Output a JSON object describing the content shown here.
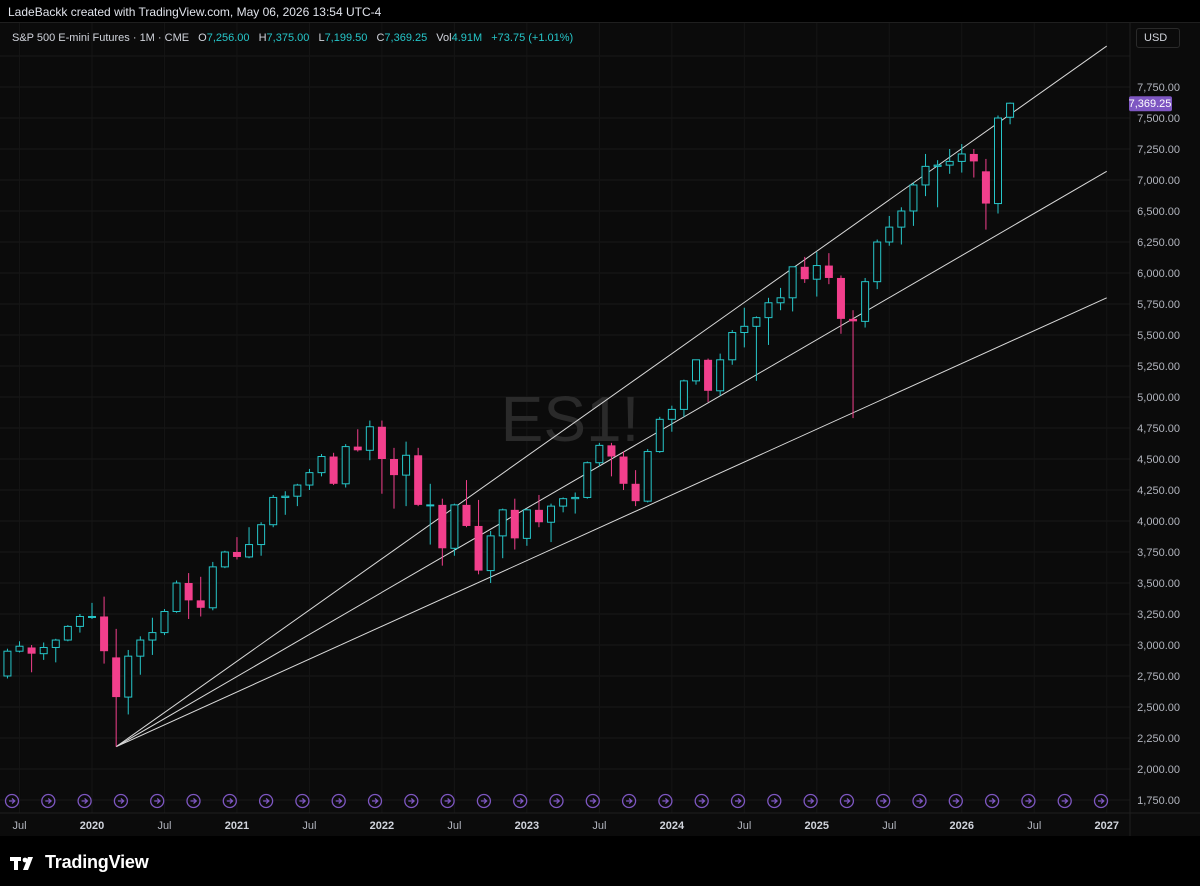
{
  "header": {
    "text": "LadeBackk created with TradingView.com, May 06, 2026 13:54 UTC-4"
  },
  "legend": {
    "symbol": "S&P 500 E-mini Futures · 1M · CME",
    "open_label": "O",
    "open": "7,256.00",
    "high_label": "H",
    "high": "7,375.00",
    "low_label": "L",
    "low": "7,199.50",
    "close_label": "C",
    "close": "7,369.25",
    "vol_label": "Vol",
    "vol": "4.91M",
    "change": "+73.75 (+1.01%)"
  },
  "currency_button": "USD",
  "watermark": "ES1!",
  "price_tag": {
    "value": "7,369.25",
    "color": "#7e57c2"
  },
  "brand": {
    "name": "TradingView"
  },
  "colors": {
    "up": "#26c6c9",
    "down": "#f23f8c",
    "line": "#d9d9d9",
    "event": "#7e57c2"
  },
  "chart_data": {
    "type": "candlestick",
    "interval": "1M",
    "y_ticks": [
      1750,
      2000,
      2250,
      2500,
      2750,
      3000,
      3250,
      3500,
      3750,
      4000,
      4250,
      4500,
      4750,
      5000,
      5250,
      5500,
      5750,
      6000,
      6250,
      6500,
      6750,
      7000,
      7250,
      7500,
      7750
    ],
    "y_tick_labels": [
      "1,750.00",
      "2,000.00",
      "2,250.00",
      "2,500.00",
      "2,750.00",
      "3,000.00",
      "3,250.00",
      "3,500.00",
      "3,750.00",
      "4,000.00",
      "4,250.00",
      "4,500.00",
      "4,750.00",
      "5,000.00",
      "5,250.00",
      "5,500.00",
      "5,750.00",
      "6,000.00",
      "6,250.00",
      "6,500.00",
      "7,000.00",
      "7,250.00",
      "7,500.00",
      "7,750.00"
    ],
    "x_ticks": [
      {
        "label": "Jul",
        "date": "2019-07",
        "bold": false
      },
      {
        "label": "2020",
        "date": "2020-01",
        "bold": true
      },
      {
        "label": "Jul",
        "date": "2020-07",
        "bold": false
      },
      {
        "label": "2021",
        "date": "2021-01",
        "bold": true
      },
      {
        "label": "Jul",
        "date": "2021-07",
        "bold": false
      },
      {
        "label": "2022",
        "date": "2022-01",
        "bold": true
      },
      {
        "label": "Jul",
        "date": "2022-07",
        "bold": false
      },
      {
        "label": "2023",
        "date": "2023-01",
        "bold": true
      },
      {
        "label": "Jul",
        "date": "2023-07",
        "bold": false
      },
      {
        "label": "2024",
        "date": "2024-01",
        "bold": true
      },
      {
        "label": "Jul",
        "date": "2024-07",
        "bold": false
      },
      {
        "label": "2025",
        "date": "2025-01",
        "bold": true
      },
      {
        "label": "Jul",
        "date": "2025-07",
        "bold": false
      },
      {
        "label": "2026",
        "date": "2026-01",
        "bold": true
      },
      {
        "label": "Jul",
        "date": "2026-07",
        "bold": false
      },
      {
        "label": "2027",
        "date": "2027-01",
        "bold": true
      }
    ],
    "candles": [
      {
        "t": "2019-06",
        "o": 2750,
        "h": 2970,
        "l": 2730,
        "c": 2950
      },
      {
        "t": "2019-07",
        "o": 2950,
        "h": 3030,
        "l": 2940,
        "c": 2990
      },
      {
        "t": "2019-08",
        "o": 2980,
        "h": 3000,
        "l": 2780,
        "c": 2930
      },
      {
        "t": "2019-09",
        "o": 2930,
        "h": 3020,
        "l": 2880,
        "c": 2980
      },
      {
        "t": "2019-10",
        "o": 2980,
        "h": 3050,
        "l": 2860,
        "c": 3040
      },
      {
        "t": "2019-11",
        "o": 3040,
        "h": 3160,
        "l": 3030,
        "c": 3150
      },
      {
        "t": "2019-12",
        "o": 3150,
        "h": 3250,
        "l": 3100,
        "c": 3230
      },
      {
        "t": "2020-01",
        "o": 3230,
        "h": 3340,
        "l": 3210,
        "c": 3230
      },
      {
        "t": "2020-02",
        "o": 3230,
        "h": 3390,
        "l": 2850,
        "c": 2950
      },
      {
        "t": "2020-03",
        "o": 2900,
        "h": 3130,
        "l": 2180,
        "c": 2580
      },
      {
        "t": "2020-04",
        "o": 2580,
        "h": 2960,
        "l": 2440,
        "c": 2910
      },
      {
        "t": "2020-05",
        "o": 2910,
        "h": 3070,
        "l": 2760,
        "c": 3040
      },
      {
        "t": "2020-06",
        "o": 3040,
        "h": 3220,
        "l": 2920,
        "c": 3100
      },
      {
        "t": "2020-07",
        "o": 3100,
        "h": 3290,
        "l": 3080,
        "c": 3270
      },
      {
        "t": "2020-08",
        "o": 3270,
        "h": 3520,
        "l": 3260,
        "c": 3500
      },
      {
        "t": "2020-09",
        "o": 3500,
        "h": 3580,
        "l": 3210,
        "c": 3360
      },
      {
        "t": "2020-10",
        "o": 3360,
        "h": 3550,
        "l": 3230,
        "c": 3300
      },
      {
        "t": "2020-11",
        "o": 3300,
        "h": 3670,
        "l": 3280,
        "c": 3630
      },
      {
        "t": "2020-12",
        "o": 3630,
        "h": 3760,
        "l": 3620,
        "c": 3750
      },
      {
        "t": "2021-01",
        "o": 3750,
        "h": 3870,
        "l": 3690,
        "c": 3710
      },
      {
        "t": "2021-02",
        "o": 3710,
        "h": 3950,
        "l": 3700,
        "c": 3810
      },
      {
        "t": "2021-03",
        "o": 3810,
        "h": 3990,
        "l": 3720,
        "c": 3970
      },
      {
        "t": "2021-04",
        "o": 3970,
        "h": 4210,
        "l": 3950,
        "c": 4190
      },
      {
        "t": "2021-05",
        "o": 4190,
        "h": 4240,
        "l": 4050,
        "c": 4200
      },
      {
        "t": "2021-06",
        "o": 4200,
        "h": 4300,
        "l": 4120,
        "c": 4290
      },
      {
        "t": "2021-07",
        "o": 4290,
        "h": 4420,
        "l": 4250,
        "c": 4390
      },
      {
        "t": "2021-08",
        "o": 4390,
        "h": 4540,
        "l": 4360,
        "c": 4520
      },
      {
        "t": "2021-09",
        "o": 4520,
        "h": 4550,
        "l": 4290,
        "c": 4300
      },
      {
        "t": "2021-10",
        "o": 4300,
        "h": 4620,
        "l": 4270,
        "c": 4600
      },
      {
        "t": "2021-11",
        "o": 4600,
        "h": 4740,
        "l": 4560,
        "c": 4570
      },
      {
        "t": "2021-12",
        "o": 4570,
        "h": 4810,
        "l": 4490,
        "c": 4760
      },
      {
        "t": "2022-01",
        "o": 4760,
        "h": 4810,
        "l": 4220,
        "c": 4500
      },
      {
        "t": "2022-02",
        "o": 4500,
        "h": 4590,
        "l": 4100,
        "c": 4370
      },
      {
        "t": "2022-03",
        "o": 4370,
        "h": 4640,
        "l": 4120,
        "c": 4530
      },
      {
        "t": "2022-04",
        "o": 4530,
        "h": 4590,
        "l": 4120,
        "c": 4130
      },
      {
        "t": "2022-05",
        "o": 4130,
        "h": 4300,
        "l": 3810,
        "c": 4130
      },
      {
        "t": "2022-06",
        "o": 4130,
        "h": 4180,
        "l": 3640,
        "c": 3780
      },
      {
        "t": "2022-07",
        "o": 3780,
        "h": 4140,
        "l": 3720,
        "c": 4130
      },
      {
        "t": "2022-08",
        "o": 4130,
        "h": 4330,
        "l": 3950,
        "c": 3960
      },
      {
        "t": "2022-09",
        "o": 3960,
        "h": 4170,
        "l": 3570,
        "c": 3600
      },
      {
        "t": "2022-10",
        "o": 3600,
        "h": 3920,
        "l": 3500,
        "c": 3880
      },
      {
        "t": "2022-11",
        "o": 3880,
        "h": 4100,
        "l": 3700,
        "c": 4090
      },
      {
        "t": "2022-12",
        "o": 4090,
        "h": 4180,
        "l": 3770,
        "c": 3860
      },
      {
        "t": "2023-01",
        "o": 3860,
        "h": 4100,
        "l": 3800,
        "c": 4090
      },
      {
        "t": "2023-02",
        "o": 4090,
        "h": 4210,
        "l": 3950,
        "c": 3990
      },
      {
        "t": "2023-03",
        "o": 3990,
        "h": 4140,
        "l": 3830,
        "c": 4120
      },
      {
        "t": "2023-04",
        "o": 4120,
        "h": 4190,
        "l": 4070,
        "c": 4180
      },
      {
        "t": "2023-05",
        "o": 4180,
        "h": 4230,
        "l": 4060,
        "c": 4190
      },
      {
        "t": "2023-06",
        "o": 4190,
        "h": 4480,
        "l": 4180,
        "c": 4470
      },
      {
        "t": "2023-07",
        "o": 4470,
        "h": 4630,
        "l": 4440,
        "c": 4610
      },
      {
        "t": "2023-08",
        "o": 4610,
        "h": 4630,
        "l": 4360,
        "c": 4520
      },
      {
        "t": "2023-09",
        "o": 4520,
        "h": 4560,
        "l": 4250,
        "c": 4300
      },
      {
        "t": "2023-10",
        "o": 4300,
        "h": 4410,
        "l": 4120,
        "c": 4160
      },
      {
        "t": "2023-11",
        "o": 4160,
        "h": 4580,
        "l": 4150,
        "c": 4560
      },
      {
        "t": "2023-12",
        "o": 4560,
        "h": 4840,
        "l": 4550,
        "c": 4820
      },
      {
        "t": "2024-01",
        "o": 4820,
        "h": 4930,
        "l": 4720,
        "c": 4900
      },
      {
        "t": "2024-02",
        "o": 4900,
        "h": 5140,
        "l": 4840,
        "c": 5130
      },
      {
        "t": "2024-03",
        "o": 5130,
        "h": 5300,
        "l": 5100,
        "c": 5300
      },
      {
        "t": "2024-04",
        "o": 5300,
        "h": 5310,
        "l": 4960,
        "c": 5050
      },
      {
        "t": "2024-05",
        "o": 5050,
        "h": 5350,
        "l": 5010,
        "c": 5300
      },
      {
        "t": "2024-06",
        "o": 5300,
        "h": 5540,
        "l": 5260,
        "c": 5520
      },
      {
        "t": "2024-07",
        "o": 5520,
        "h": 5720,
        "l": 5400,
        "c": 5570
      },
      {
        "t": "2024-08",
        "o": 5570,
        "h": 5650,
        "l": 5130,
        "c": 5640
      },
      {
        "t": "2024-09",
        "o": 5640,
        "h": 5800,
        "l": 5420,
        "c": 5760
      },
      {
        "t": "2024-10",
        "o": 5760,
        "h": 5880,
        "l": 5700,
        "c": 5800
      },
      {
        "t": "2024-11",
        "o": 5800,
        "h": 6050,
        "l": 5690,
        "c": 6050
      },
      {
        "t": "2024-12",
        "o": 6050,
        "h": 6130,
        "l": 5920,
        "c": 5950
      },
      {
        "t": "2025-01",
        "o": 5950,
        "h": 6170,
        "l": 5810,
        "c": 6060
      },
      {
        "t": "2025-02",
        "o": 6060,
        "h": 6160,
        "l": 5910,
        "c": 5960
      },
      {
        "t": "2025-03",
        "o": 5960,
        "h": 5980,
        "l": 5510,
        "c": 5630
      },
      {
        "t": "2025-04",
        "o": 5630,
        "h": 5700,
        "l": 4830,
        "c": 5610
      },
      {
        "t": "2025-05",
        "o": 5610,
        "h": 5960,
        "l": 5560,
        "c": 5930
      },
      {
        "t": "2025-06",
        "o": 5930,
        "h": 6270,
        "l": 5870,
        "c": 6250
      },
      {
        "t": "2025-07",
        "o": 6250,
        "h": 6460,
        "l": 6220,
        "c": 6370
      },
      {
        "t": "2025-08",
        "o": 6370,
        "h": 6530,
        "l": 6230,
        "c": 6500
      },
      {
        "t": "2025-09",
        "o": 6500,
        "h": 6730,
        "l": 6380,
        "c": 6710
      },
      {
        "t": "2025-10",
        "o": 6710,
        "h": 6960,
        "l": 6620,
        "c": 6860
      },
      {
        "t": "2025-11",
        "o": 6860,
        "h": 6910,
        "l": 6530,
        "c": 6870
      },
      {
        "t": "2025-12",
        "o": 6870,
        "h": 7000,
        "l": 6800,
        "c": 6900
      },
      {
        "t": "2026-01",
        "o": 6900,
        "h": 7040,
        "l": 6810,
        "c": 6960
      },
      {
        "t": "2026-02",
        "o": 6960,
        "h": 7000,
        "l": 6770,
        "c": 6900
      },
      {
        "t": "2026-03",
        "o": 6820,
        "h": 6920,
        "l": 6350,
        "c": 6560
      },
      {
        "t": "2026-04",
        "o": 6560,
        "h": 7270,
        "l": 6480,
        "c": 7250
      },
      {
        "t": "2026-05",
        "o": 7256,
        "h": 7375,
        "l": 7199.5,
        "c": 7369.25
      }
    ],
    "trend_lines": [
      {
        "from": {
          "t": "2020-03",
          "p": 2180
        },
        "to": {
          "t": "2027-01",
          "p": 7830
        }
      },
      {
        "from": {
          "t": "2020-03",
          "p": 2180
        },
        "to": {
          "t": "2027-01",
          "p": 6820
        }
      },
      {
        "from": {
          "t": "2020-03",
          "p": 2180
        },
        "to": {
          "t": "2027-01",
          "p": 5800
        }
      }
    ]
  }
}
